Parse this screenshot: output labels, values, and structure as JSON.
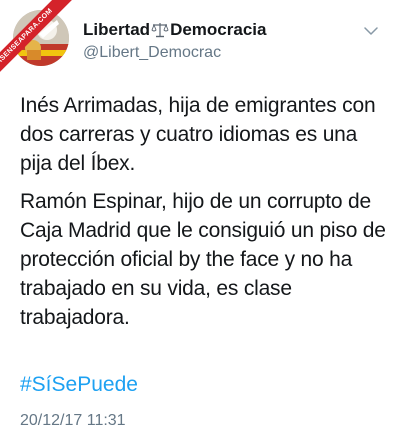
{
  "watermark": "ASENSEAPARA.COM",
  "user": {
    "name_part1": "Libertad",
    "name_part2": "Democracia",
    "handle": "@Libert_Democrac",
    "name_icon": "scales-of-justice-icon"
  },
  "tweet": {
    "paragraphs": [
      "Inés Arrimadas, hija de emigrantes con dos carreras y cuatro idiomas es una pija del Íbex.",
      "Ramón Espinar, hijo de un corrupto de Caja Madrid que le consiguió un piso de protección oficial by the face y no ha trabajado en su vida, es clase trabajadora."
    ],
    "hashtag": "#SíSePuede",
    "timestamp": "20/12/17 11:31"
  },
  "colors": {
    "text": "#14171a",
    "secondary": "#657786",
    "link": "#1da1f2",
    "watermark_bg": "#d4232a"
  }
}
